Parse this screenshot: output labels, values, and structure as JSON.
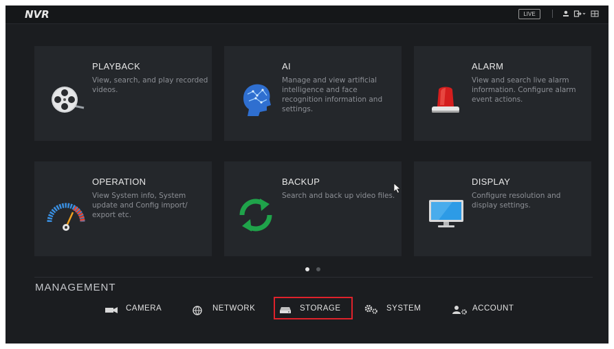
{
  "header": {
    "logo": "NVR",
    "live_label": "LIVE",
    "icons": [
      "user-icon",
      "logout-icon",
      "grid-icon"
    ]
  },
  "cards": [
    {
      "title": "PLAYBACK",
      "desc": "View, search, and play recorded videos.",
      "icon": "film-reel-icon"
    },
    {
      "title": "AI",
      "desc": "Manage and view artificial intelligence and face recognition information and settings.",
      "icon": "brain-head-icon"
    },
    {
      "title": "ALARM",
      "desc": "View and search live alarm information. Configure alarm event actions.",
      "icon": "alarm-light-icon"
    },
    {
      "title": "OPERATION",
      "desc": "View System info, System update and Config import/ export etc.",
      "icon": "gauge-icon"
    },
    {
      "title": "BACKUP",
      "desc": "Search and back up video files.",
      "icon": "sync-arrows-icon"
    },
    {
      "title": "DISPLAY",
      "desc": "Configure resolution and display settings.",
      "icon": "monitor-icon"
    }
  ],
  "pagination": {
    "current": 1,
    "total": 2
  },
  "management": {
    "title": "MANAGEMENT",
    "items": [
      {
        "label": "CAMERA",
        "icon": "camera-icon"
      },
      {
        "label": "NETWORK",
        "icon": "globe-icon"
      },
      {
        "label": "STORAGE",
        "icon": "hard-drive-icon",
        "highlighted": true
      },
      {
        "label": "SYSTEM",
        "icon": "gears-icon"
      },
      {
        "label": "ACCOUNT",
        "icon": "user-gear-icon"
      }
    ]
  },
  "colors": {
    "background": "#1b1d20",
    "card": "#24272b",
    "highlight": "#e0222b"
  }
}
